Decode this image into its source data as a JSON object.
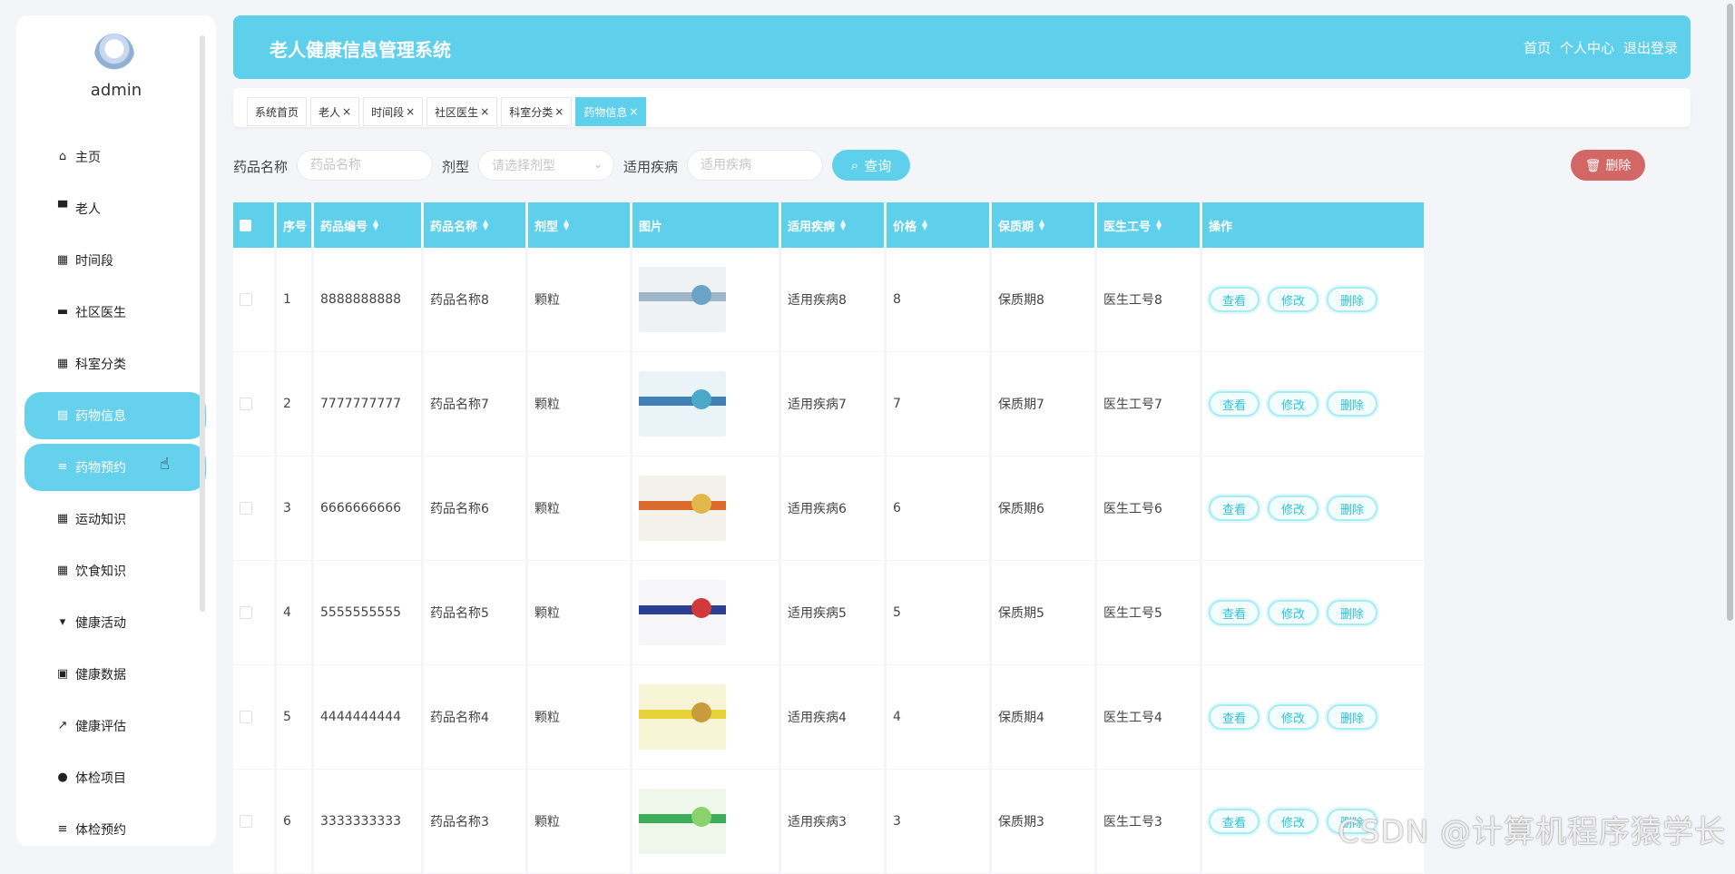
{
  "sidebar": {
    "username": "admin",
    "items": [
      {
        "icon": "home-icon",
        "glyph": "⌂",
        "label": "主页"
      },
      {
        "icon": "monitor-icon",
        "glyph": "▀",
        "label": "老人"
      },
      {
        "icon": "grid-icon",
        "glyph": "▦",
        "label": "时间段"
      },
      {
        "icon": "card-icon",
        "glyph": "▬",
        "label": "社区医生"
      },
      {
        "icon": "grid-icon",
        "glyph": "▦",
        "label": "科室分类"
      },
      {
        "icon": "table-icon",
        "glyph": "▤",
        "label": "药物信息",
        "active": true
      },
      {
        "icon": "list-icon",
        "glyph": "≡",
        "label": "药物预约",
        "active": true
      },
      {
        "icon": "grid-icon",
        "glyph": "▦",
        "label": "运动知识"
      },
      {
        "icon": "grid-icon",
        "glyph": "▦",
        "label": "饮食知识"
      },
      {
        "icon": "signpost-icon",
        "glyph": "▾",
        "label": "健康活动"
      },
      {
        "icon": "clipboard-icon",
        "glyph": "▣",
        "label": "健康数据"
      },
      {
        "icon": "chart-icon",
        "glyph": "↗",
        "label": "健康评估"
      },
      {
        "icon": "bulb-icon",
        "glyph": "●",
        "label": "体检项目"
      },
      {
        "icon": "list-icon",
        "glyph": "≡",
        "label": "体检预约"
      }
    ]
  },
  "header": {
    "title": "老人健康信息管理系统",
    "links": [
      "首页",
      "个人中心",
      "退出登录"
    ]
  },
  "tabs": [
    {
      "label": "系统首页",
      "closable": false
    },
    {
      "label": "老人",
      "closable": true
    },
    {
      "label": "时间段",
      "closable": true
    },
    {
      "label": "社区医生",
      "closable": true
    },
    {
      "label": "科室分类",
      "closable": true
    },
    {
      "label": "药物信息",
      "closable": true,
      "active": true
    }
  ],
  "search": {
    "name_label": "药品名称",
    "name_placeholder": "药品名称",
    "type_label": "剂型",
    "type_placeholder": "请选择剂型",
    "disease_label": "适用疾病",
    "disease_placeholder": "适用疾病",
    "query_label": "查询",
    "delete_label": "删除"
  },
  "table": {
    "headers": [
      "序号",
      "药品编号",
      "药品名称",
      "剂型",
      "图片",
      "适用疾病",
      "价格",
      "保质期",
      "医生工号",
      "操作"
    ],
    "sortable": [
      false,
      true,
      true,
      true,
      false,
      true,
      true,
      true,
      true,
      false
    ],
    "rows": [
      {
        "no": "1",
        "code": "8888888888",
        "name": "药品名称8",
        "form": "颗粒",
        "disease": "适用疾病8",
        "price": "8",
        "shelf": "保质期8",
        "doctor": "医生工号8",
        "img": {
          "bg": "#eef2f4",
          "band": "#9fb6c9",
          "dot": "#6aa3c8"
        }
      },
      {
        "no": "2",
        "code": "7777777777",
        "name": "药品名称7",
        "form": "颗粒",
        "disease": "适用疾病7",
        "price": "7",
        "shelf": "保质期7",
        "doctor": "医生工号7",
        "img": {
          "bg": "#eaf3f7",
          "band": "#3f7fb5",
          "dot": "#4aa9c9"
        }
      },
      {
        "no": "3",
        "code": "6666666666",
        "name": "药品名称6",
        "form": "颗粒",
        "disease": "适用疾病6",
        "price": "6",
        "shelf": "保质期6",
        "doctor": "医生工号6",
        "img": {
          "bg": "#f4f1ea",
          "band": "#d96b2f",
          "dot": "#e2b84a"
        }
      },
      {
        "no": "4",
        "code": "5555555555",
        "name": "药品名称5",
        "form": "颗粒",
        "disease": "适用疾病5",
        "price": "5",
        "shelf": "保质期5",
        "doctor": "医生工号5",
        "img": {
          "bg": "#f6f6f8",
          "band": "#2d3f93",
          "dot": "#d23a3a"
        }
      },
      {
        "no": "5",
        "code": "4444444444",
        "name": "药品名称4",
        "form": "颗粒",
        "disease": "适用疾病4",
        "price": "4",
        "shelf": "保质期4",
        "doctor": "医生工号4",
        "img": {
          "bg": "#f7f5d6",
          "band": "#e8d23a",
          "dot": "#c89b3c"
        }
      },
      {
        "no": "6",
        "code": "3333333333",
        "name": "药品名称3",
        "form": "颗粒",
        "disease": "适用疾病3",
        "price": "3",
        "shelf": "保质期3",
        "doctor": "医生工号3",
        "img": {
          "bg": "#eef7ea",
          "band": "#3cae5a",
          "dot": "#8bd16c"
        }
      }
    ],
    "actions": [
      "查看",
      "修改",
      "删除"
    ]
  },
  "watermark": "CSDN @计算机程序猿学长"
}
